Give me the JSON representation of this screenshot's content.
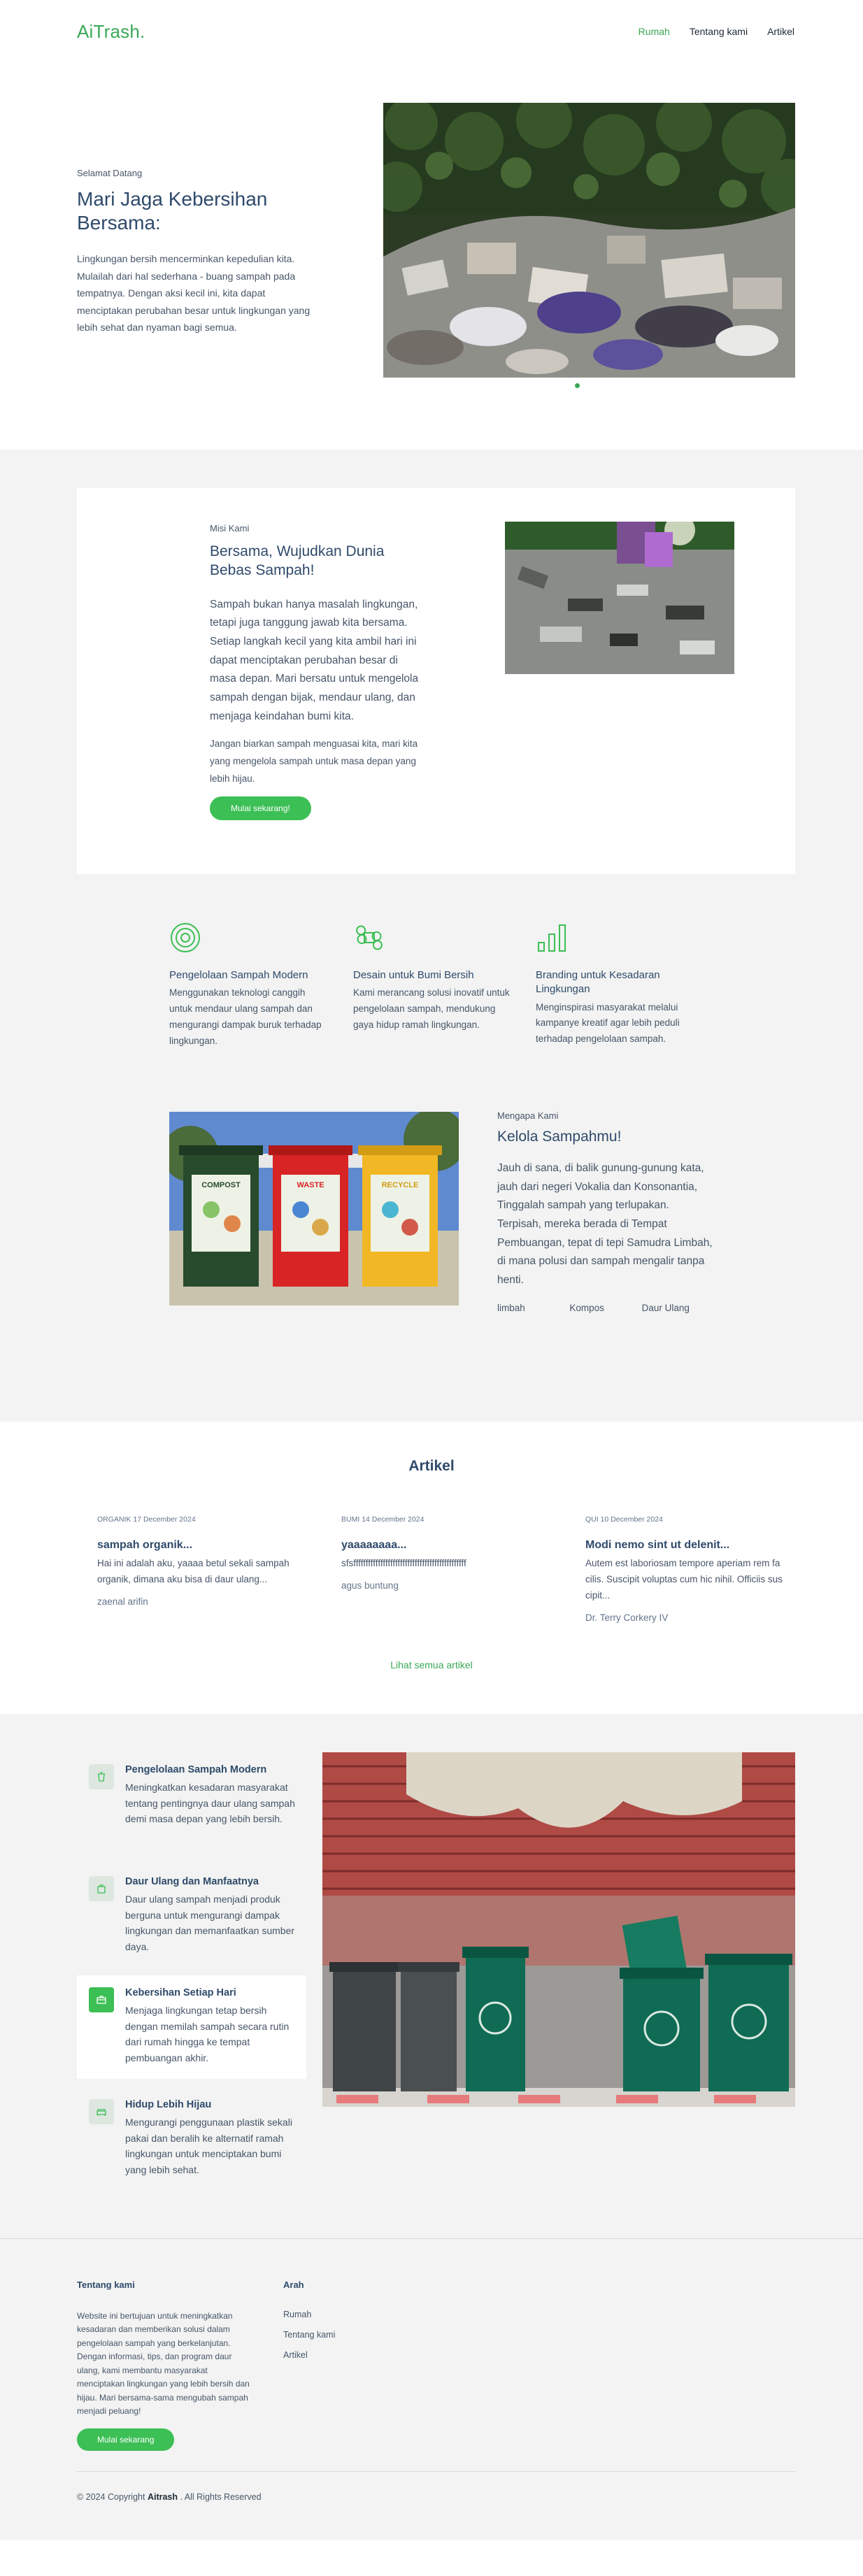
{
  "nav": {
    "logo": "AiTrash.",
    "links": [
      "Rumah",
      "Tentang kami",
      "Artikel"
    ]
  },
  "hero": {
    "kicker": "Selamat Datang",
    "title": "Mari Jaga Kebersihan Bersama:",
    "desc": "Lingkungan bersih mencerminkan kepedulian kita. Mulailah dari hal sederhana - buang sampah pada tempatnya. Dengan aksi kecil ini, kita dapat menciptakan perubahan besar untuk lingkungan yang lebih sehat dan nyaman bagi semua."
  },
  "mission": {
    "kicker": "Misi Kami",
    "title": "Bersama, Wujudkan Dunia Bebas Sampah!",
    "p1": "Sampah bukan hanya masalah lingkungan, tetapi juga tanggung jawab kita bersama. Setiap langkah kecil yang kita ambil hari ini dapat menciptakan perubahan besar di masa depan. Mari bersatu untuk mengelola sampah dengan bijak, mendaur ulang, dan menjaga keindahan bumi kita.",
    "p2": "Jangan biarkan sampah menguasai kita, mari kita yang mengelola sampah untuk masa depan yang lebih hijau.",
    "button": "Mulai sekarang!"
  },
  "features": [
    {
      "icon": "target-icon",
      "title": "Pengelolaan Sampah Modern",
      "desc": "Menggunakan teknologi canggih untuk mendaur ulang sampah dan mengurangi dampak buruk terhadap lingkungan."
    },
    {
      "icon": "command-icon",
      "title": "Desain untuk Bumi Bersih",
      "desc": "Kami merancang solusi inovatif untuk pengelolaan sampah, mendukung gaya hidup ramah lingkungan."
    },
    {
      "icon": "bar-chart-icon",
      "title": "Branding untuk Kesadaran Lingkungan",
      "desc": "Menginspirasi masyarakat melalui kampanye kreatif agar lebih peduli terhadap pengelolaan sampah."
    }
  ],
  "kelola": {
    "kicker": "Mengapa Kami",
    "title": "Kelola Sampahmu!",
    "desc": "Jauh di sana, di balik gunung-gunung kata, jauh dari negeri Vokalia dan Konsonantia, Tinggalah sampah yang terlupakan. Terpisah, mereka berada di Tempat Pembuangan, tepat di tepi Samudra Limbah, di mana polusi dan sampah mengalir tanpa henti.",
    "tags": [
      "limbah",
      "Kompos",
      "Daur Ulang"
    ],
    "bin_labels": [
      "COMPOST",
      "WASTE",
      "RECYCLE"
    ]
  },
  "artikel": {
    "title": "Artikel",
    "items": [
      {
        "category": "ORGANIK",
        "date": "17 December 2024",
        "title": "sampah organik...",
        "excerpt": "Hai ini adalah aku, yaaaa betul sekali sampah organik, dimana aku bisa di daur ulang...",
        "author": "zaenal arifin"
      },
      {
        "category": "BUMI",
        "date": "14 December 2024",
        "title": "yaaaaaaaa...",
        "excerpt": "sfsffffffffffffffffffffffffffffffffffffffffffffff",
        "author": "agus buntung"
      },
      {
        "category": "QUI",
        "date": "10 December 2024",
        "title": "Modi nemo sint ut delenit...",
        "excerpt": "Autem est laboriosam tempore aperiam rem facilis. Suscipit voluptas cum hic nihil. Officiis suscipit...",
        "author": "Dr. Terry Corkery IV"
      }
    ],
    "see_all": "Lihat semua artikel"
  },
  "benefits": [
    {
      "icon": "recycle-bin-icon",
      "title": "Pengelolaan Sampah Modern",
      "desc": "Meningkatkan kesadaran masyarakat tentang pentingnya daur ulang sampah demi masa depan yang lebih bersih.",
      "active": false
    },
    {
      "icon": "bag-icon",
      "title": "Daur Ulang dan Manfaatnya",
      "desc": "Daur ulang sampah menjadi produk berguna untuk mengurangi dampak lingkungan dan memanfaatkan sumber daya.",
      "active": false
    },
    {
      "icon": "briefcase-icon",
      "title": "Kebersihan Setiap Hari",
      "desc": "Menjaga lingkungan tetap bersih dengan memilah sampah secara rutin dari rumah hingga ke tempat pembuangan akhir.",
      "active": true
    },
    {
      "icon": "sofa-icon",
      "title": "Hidup Lebih Hijau",
      "desc": "Mengurangi penggunaan plastik sekali pakai dan beralih ke alternatif ramah lingkungan untuk menciptakan bumi yang lebih sehat.",
      "active": false
    }
  ],
  "footer": {
    "about_title": "Tentang kami",
    "about_desc": "Website ini bertujuan untuk meningkatkan kesadaran dan memberikan solusi dalam pengelolaan sampah yang berkelanjutan. Dengan informasi, tips, dan program daur ulang, kami membantu masyarakat menciptakan lingkungan yang lebih bersih dan hijau. Mari bersama-sama mengubah sampah menjadi peluang!",
    "button": "Mulai sekarang",
    "nav_title": "Arah",
    "nav_links": [
      "Rumah",
      "Tentang kami",
      "Artikel"
    ],
    "copyright_pre": "© 2024 Copyright",
    "copyright_brand": "Aitrash",
    "copyright_post": ". All Rights Reserved"
  },
  "colors": {
    "accent": "#3aa856",
    "button": "#3cbf55",
    "heading": "#2f4a6b",
    "section_bg": "#f2f3f2"
  }
}
